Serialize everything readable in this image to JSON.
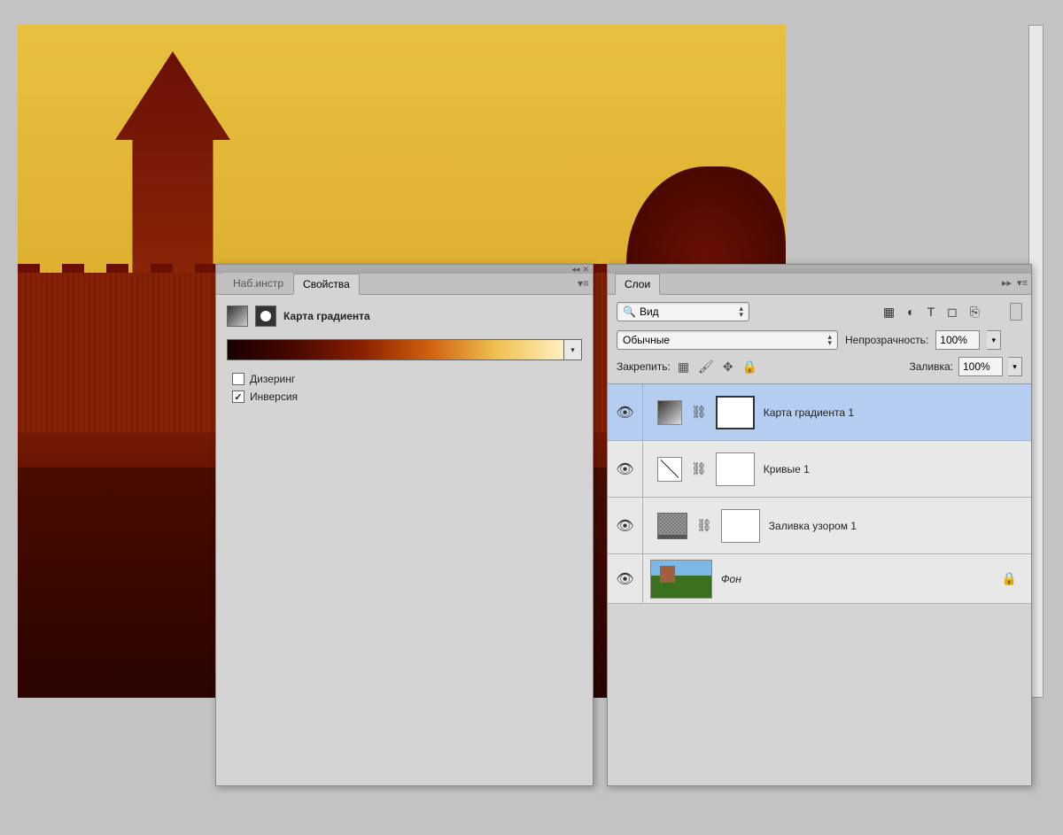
{
  "properties_panel": {
    "tab_tools": "Наб.инстр",
    "tab_properties": "Свойства",
    "title": "Карта градиента",
    "dither_label": "Дизеринг",
    "dither_checked": false,
    "invert_label": "Инверсия",
    "invert_checked": true
  },
  "layers_panel": {
    "tab_title": "Слои",
    "filter_dropdown": "Вид",
    "blend_mode": "Обычные",
    "opacity_label": "Непрозрачность:",
    "opacity_value": "100%",
    "lock_label": "Закрепить:",
    "fill_label": "Заливка:",
    "fill_value": "100%",
    "layers": [
      {
        "name": "Карта градиента 1",
        "type": "gradient-map",
        "selected": true
      },
      {
        "name": "Кривые 1",
        "type": "curves",
        "selected": false
      },
      {
        "name": "Заливка узором 1",
        "type": "pattern-fill",
        "selected": false
      },
      {
        "name": "Фон",
        "type": "background",
        "selected": false,
        "locked": true
      }
    ]
  }
}
